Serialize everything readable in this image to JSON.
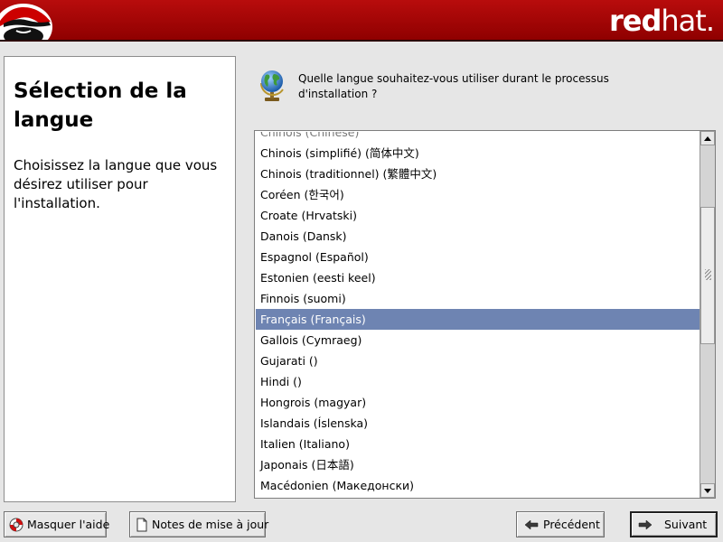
{
  "banner": {
    "wordmark_bold": "red",
    "wordmark_light": "hat.",
    "logo_icon": "shadowman-logo"
  },
  "help": {
    "title": "Sélection de la langue",
    "text": "Choisissez la langue que vous désirez utiliser pour l'installation."
  },
  "question": {
    "icon": "globe-icon",
    "text": "Quelle langue souhaitez-vous utiliser durant le processus d'installation ?"
  },
  "language_list": {
    "items": [
      "Chinois (Chinese)",
      "Chinois (simplifié) (简体中文)",
      "Chinois (traditionnel) (繁體中文)",
      "Coréen (한국어)",
      "Croate (Hrvatski)",
      "Danois (Dansk)",
      "Espagnol (Español)",
      "Estonien (eesti keel)",
      "Finnois (suomi)",
      "Français (Français)",
      "Gallois (Cymraeg)",
      "Gujarati ()",
      "Hindi ()",
      "Hongrois (magyar)",
      "Islandais (Íslenska)",
      "Italien (Italiano)",
      "Japonais (日本語)",
      "Macédonien (Македонски)"
    ],
    "selected": "Français (Français)"
  },
  "buttons": {
    "hide_help": "Masquer l'aide",
    "release_notes": "Notes de mise à jour",
    "back": "Précédent",
    "next": "Suivant"
  },
  "colors": {
    "banner_red": "#a00000",
    "selection": "#6e84b2",
    "background": "#e6e6e6"
  }
}
